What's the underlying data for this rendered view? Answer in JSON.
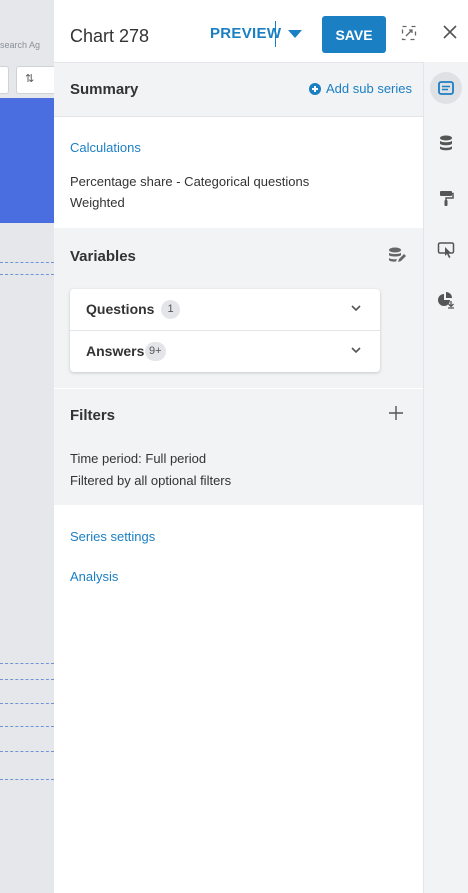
{
  "background": {
    "search_text": "search Ag"
  },
  "header": {
    "title": "Chart 278",
    "preview_label": "PREVIEW",
    "save_label": "SAVE"
  },
  "summary": {
    "heading": "Summary",
    "add_sub_series_label": "Add sub series"
  },
  "calculations": {
    "link_label": "Calculations",
    "lines": [
      "Percentage share - Categorical questions",
      "Weighted"
    ]
  },
  "variables": {
    "heading": "Variables",
    "rows": [
      {
        "label": "Questions",
        "count": "1"
      },
      {
        "label": "Answers",
        "count": "9+"
      }
    ]
  },
  "filters": {
    "heading": "Filters",
    "lines": [
      "Time period: Full period",
      "Filtered by all optional filters"
    ]
  },
  "links": {
    "series_settings": "Series settings",
    "analysis": "Analysis"
  },
  "rail": {
    "icons": [
      "summary-icon",
      "database-icon",
      "paint-roller-icon",
      "interaction-icon",
      "pie-chart-export-icon"
    ],
    "active": "summary-icon"
  },
  "colors": {
    "accent": "#1b7fc4",
    "section_bg": "#f2f3f4",
    "text": "#333333"
  }
}
